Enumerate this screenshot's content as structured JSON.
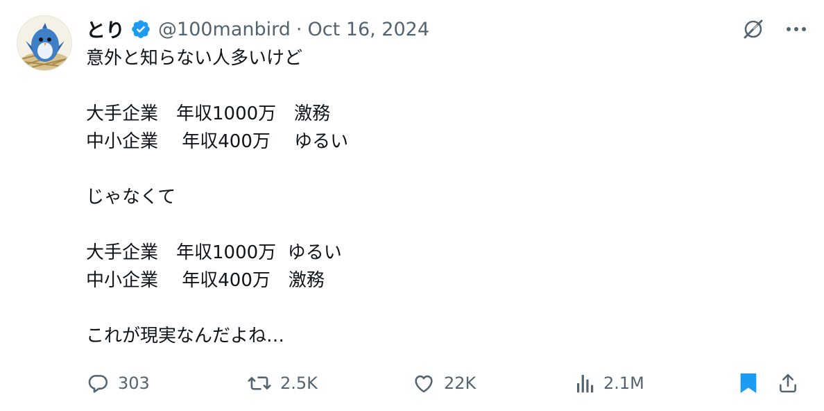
{
  "author": {
    "display_name": "とり",
    "handle": "@100manbird",
    "separator": "·",
    "date": "Oct 16, 2024",
    "verified": true,
    "verified_color": "#1d9bf0"
  },
  "tweet": {
    "lines": [
      "意外と知らない人多いけど",
      "",
      "大手企業　年収1000万　激務",
      "中小企業　 年収400万　 ゆるい",
      "",
      "じゃなくて",
      "",
      "大手企業　年収1000万  ゆるい",
      "中小企業　 年収400万　激務",
      "",
      "これが現実なんだよね…"
    ]
  },
  "actions": {
    "replies": {
      "count": "303",
      "icon": "reply-icon"
    },
    "reposts": {
      "count": "2.5K",
      "icon": "repost-icon"
    },
    "likes": {
      "count": "22K",
      "icon": "heart-icon"
    },
    "views": {
      "count": "2.1M",
      "icon": "views-icon"
    },
    "bookmark": {
      "icon": "bookmark-icon",
      "active": true,
      "color": "#1d9bf0"
    },
    "share": {
      "icon": "share-icon"
    }
  },
  "icons": {
    "top_right": [
      "grok-icon",
      "more-icon"
    ]
  },
  "colors": {
    "text": "#0f1419",
    "secondary": "#536471",
    "accent": "#1d9bf0"
  }
}
